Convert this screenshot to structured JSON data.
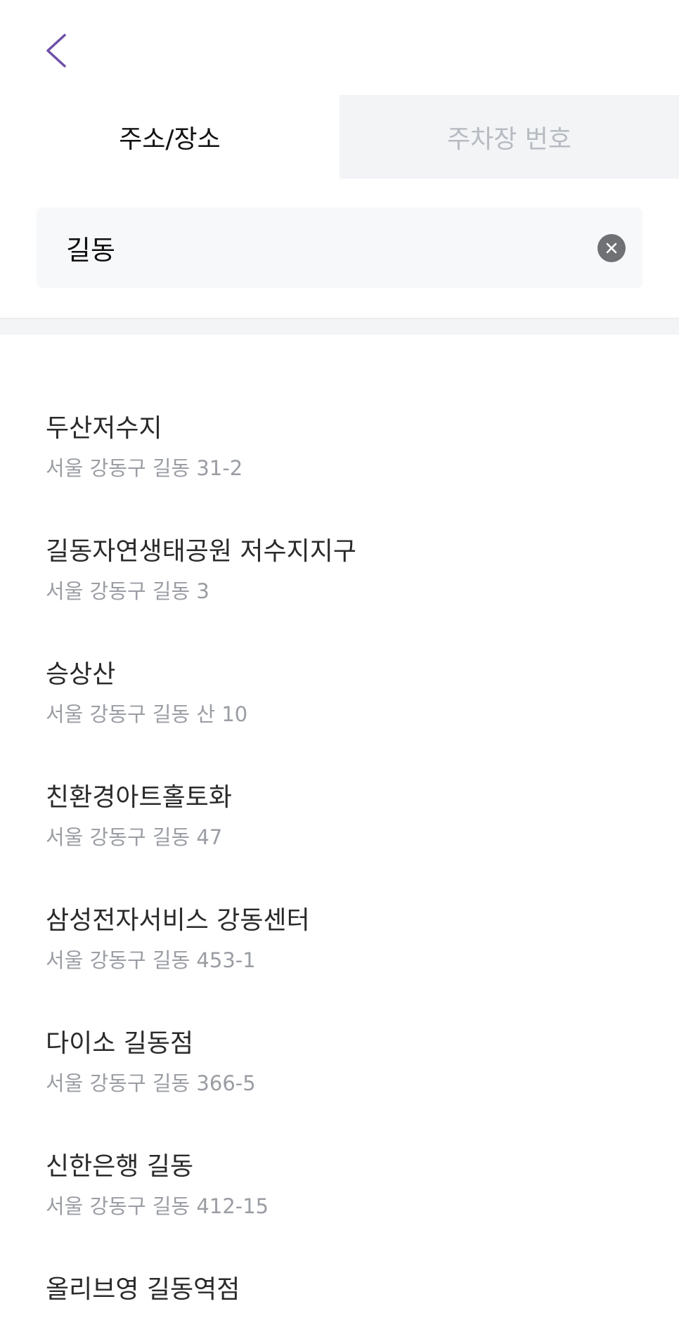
{
  "header": {
    "back_icon": "chevron-left-icon",
    "accent_color": "#6e4fa6"
  },
  "tabs": [
    {
      "label": "주소/장소",
      "active": true
    },
    {
      "label": "주차장 번호",
      "active": false
    }
  ],
  "search": {
    "value": "길동",
    "clear_icon": "clear-icon"
  },
  "results": [
    {
      "name": "두산저수지",
      "address": "서울 강동구 길동 31-2"
    },
    {
      "name": "길동자연생태공원 저수지지구",
      "address": "서울 강동구 길동 3"
    },
    {
      "name": "승상산",
      "address": "서울 강동구 길동 산 10"
    },
    {
      "name": "친환경아트홀토화",
      "address": "서울 강동구 길동 47"
    },
    {
      "name": "삼성전자서비스 강동센터",
      "address": "서울 강동구 길동 453-1"
    },
    {
      "name": "다이소 길동점",
      "address": "서울 강동구 길동 366-5"
    },
    {
      "name": "신한은행 길동",
      "address": "서울 강동구 길동 412-15"
    },
    {
      "name": "올리브영 길동역점",
      "address": ""
    }
  ]
}
